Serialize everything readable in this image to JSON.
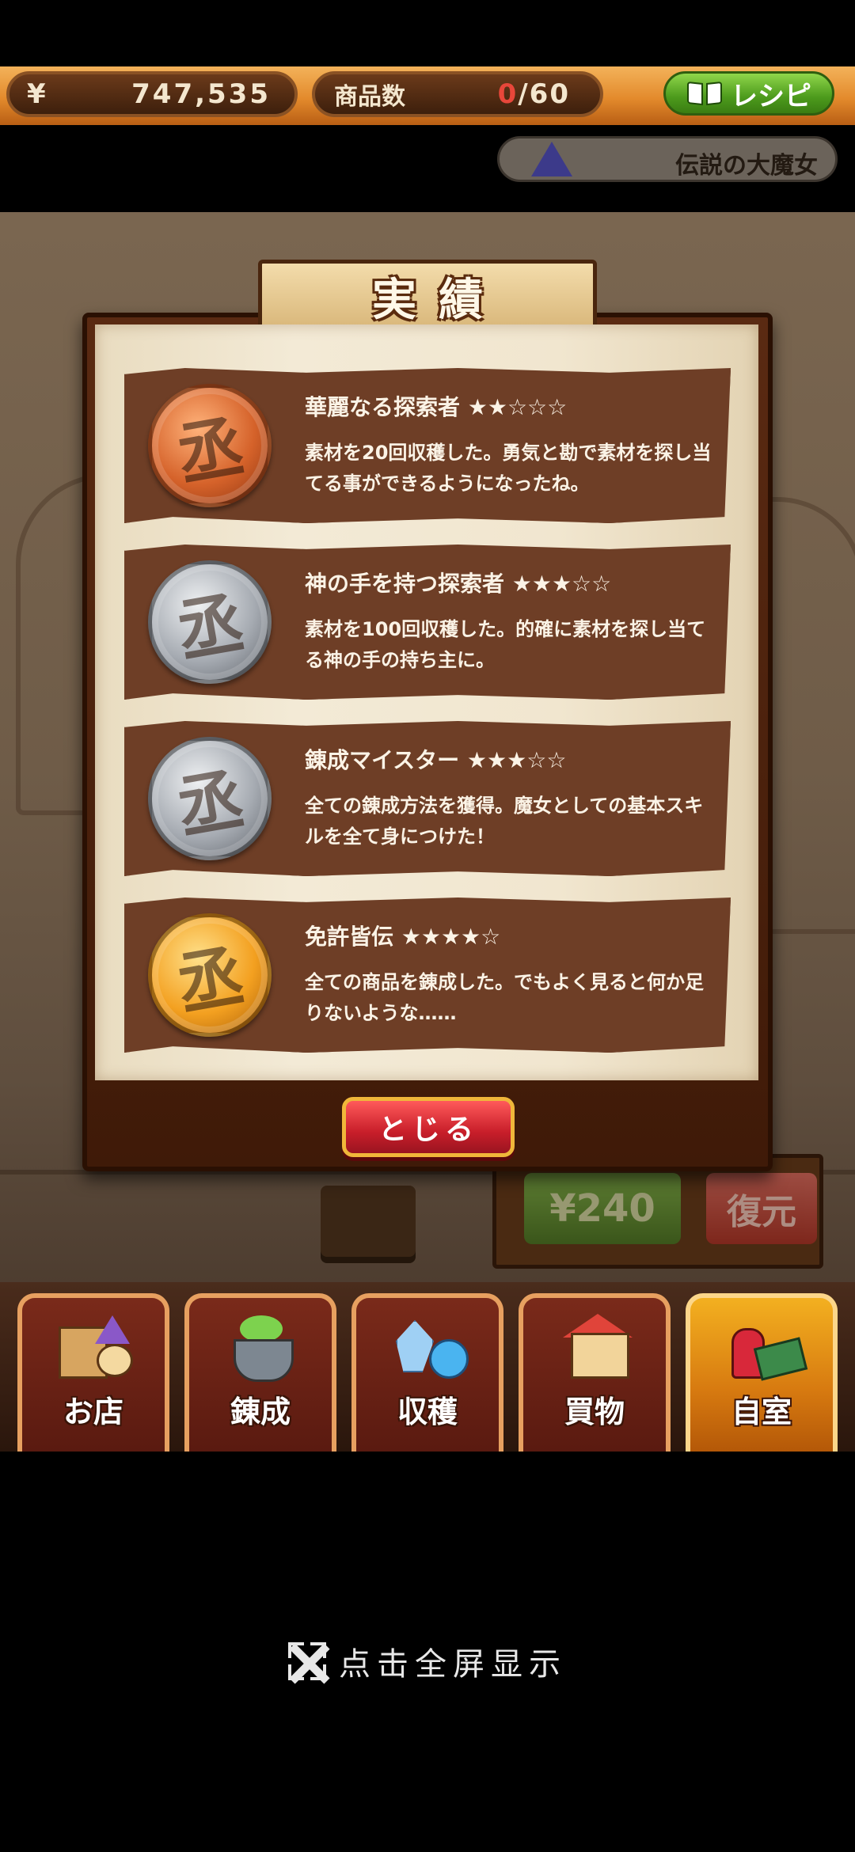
{
  "header": {
    "money_symbol": "¥",
    "money": "747,535",
    "goods_label": "商品数",
    "goods_current": "0",
    "goods_total": "/60",
    "recipe_label": "レシピ",
    "player_title": "伝説の大魔女"
  },
  "scene": {
    "price_label": "¥240",
    "restore_label": "復元"
  },
  "modal": {
    "title": "実績",
    "close_label": "とじる",
    "achievements": [
      {
        "title": "華麗なる探索者 ★★☆☆☆",
        "desc": "素材を20回収穫した。勇気と勘で素材を探し当てる事ができるようになったね。",
        "medal": "bronze",
        "rating": 2
      },
      {
        "title": "神の手を持つ探索者 ★★★☆☆",
        "desc": "素材を100回収穫した。的確に素材を探し当てる神の手の持ち主に。",
        "medal": "silver",
        "rating": 3
      },
      {
        "title": "錬成マイスター ★★★☆☆",
        "desc": "全ての錬成方法を獲得。魔女としての基本スキルを全て身につけた！",
        "medal": "silver",
        "rating": 3
      },
      {
        "title": "免許皆伝 ★★★★☆",
        "desc": "全ての商品を錬成した。でもよく見ると何か足りないような……",
        "medal": "gold",
        "rating": 4
      }
    ]
  },
  "nav": {
    "items": [
      {
        "label": "お店",
        "icon": "shop-icon"
      },
      {
        "label": "錬成",
        "icon": "cauldron-icon"
      },
      {
        "label": "収穫",
        "icon": "crystal-icon"
      },
      {
        "label": "買物",
        "icon": "house-icon"
      },
      {
        "label": "自室",
        "icon": "room-icon",
        "active": true
      }
    ]
  },
  "fullscreen_hint": "点击全屏显示",
  "colors": {
    "accent_orange": "#e38a2c",
    "recipe_green": "#4c9a1c",
    "close_red": "#c81e2a",
    "card_brown": "#6e3e26"
  }
}
